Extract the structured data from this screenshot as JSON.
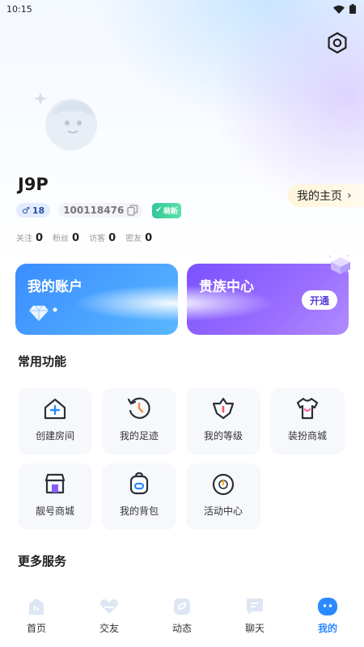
{
  "status_bar": {
    "time": "10:15"
  },
  "profile": {
    "username": "J9P",
    "gender_level": "18",
    "user_id": "100118476",
    "new_badge": "萌新",
    "homepage_link": "我的主页"
  },
  "stats": [
    {
      "label": "关注",
      "value": "0"
    },
    {
      "label": "粉丝",
      "value": "0"
    },
    {
      "label": "访客",
      "value": "0"
    },
    {
      "label": "密友",
      "value": "0"
    }
  ],
  "cards": {
    "account_title": "我的账户",
    "vip_title": "贵族中心",
    "vip_button": "开通"
  },
  "sections": {
    "common": "常用功能",
    "more": "更多服务"
  },
  "features": [
    {
      "label": "创建房间",
      "icon": "create-room-icon"
    },
    {
      "label": "我的足迹",
      "icon": "history-icon"
    },
    {
      "label": "我的等级",
      "icon": "level-icon"
    },
    {
      "label": "装扮商城",
      "icon": "dress-shop-icon"
    },
    {
      "label": "靓号商城",
      "icon": "number-shop-icon"
    },
    {
      "label": "我的背包",
      "icon": "backpack-icon"
    },
    {
      "label": "活动中心",
      "icon": "activity-icon"
    }
  ],
  "tabs": [
    {
      "label": "首页"
    },
    {
      "label": "交友"
    },
    {
      "label": "动态"
    },
    {
      "label": "聊天"
    },
    {
      "label": "我的"
    }
  ],
  "colors": {
    "accent": "#2b8aff",
    "account_card": "#3b8dff",
    "vip_card": "#7a52ff"
  }
}
